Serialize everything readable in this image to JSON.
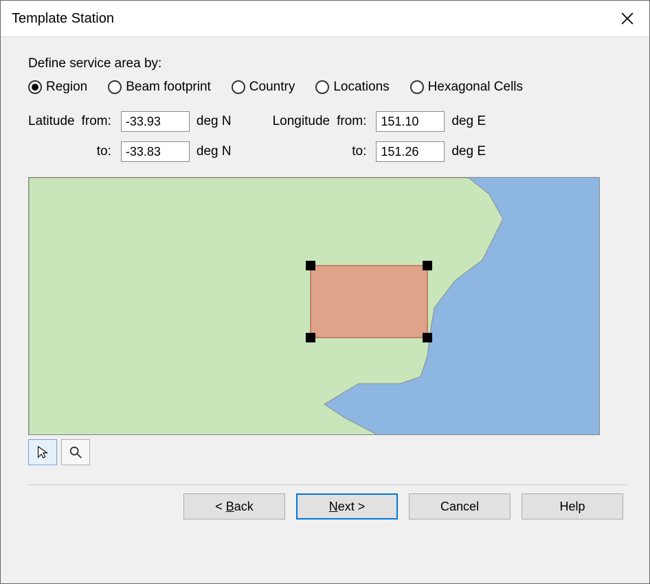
{
  "title": "Template Station",
  "heading": "Define service area by:",
  "radios": {
    "region": "Region",
    "beam": "Beam footprint",
    "country": "Country",
    "locations": "Locations",
    "hex": "Hexagonal Cells",
    "selected": "region"
  },
  "coords": {
    "latitude_label": "Latitude",
    "longitude_label": "Longitude",
    "from_label": "from:",
    "to_label": "to:",
    "deg_n": "deg N",
    "deg_e": "deg E",
    "lat_from": "-33.93",
    "lat_to": "-33.83",
    "lon_from": "151.10",
    "lon_to": "151.26"
  },
  "tools": {
    "pointer": "pointer-tool",
    "zoom": "zoom-tool"
  },
  "buttons": {
    "back": "< Back",
    "next": "Next >",
    "cancel": "Cancel",
    "help": "Help"
  },
  "map": {
    "land_color": "#c8e6b9",
    "water_color": "#8db7e2",
    "selection_color": "rgba(230,140,120,0.75)"
  }
}
